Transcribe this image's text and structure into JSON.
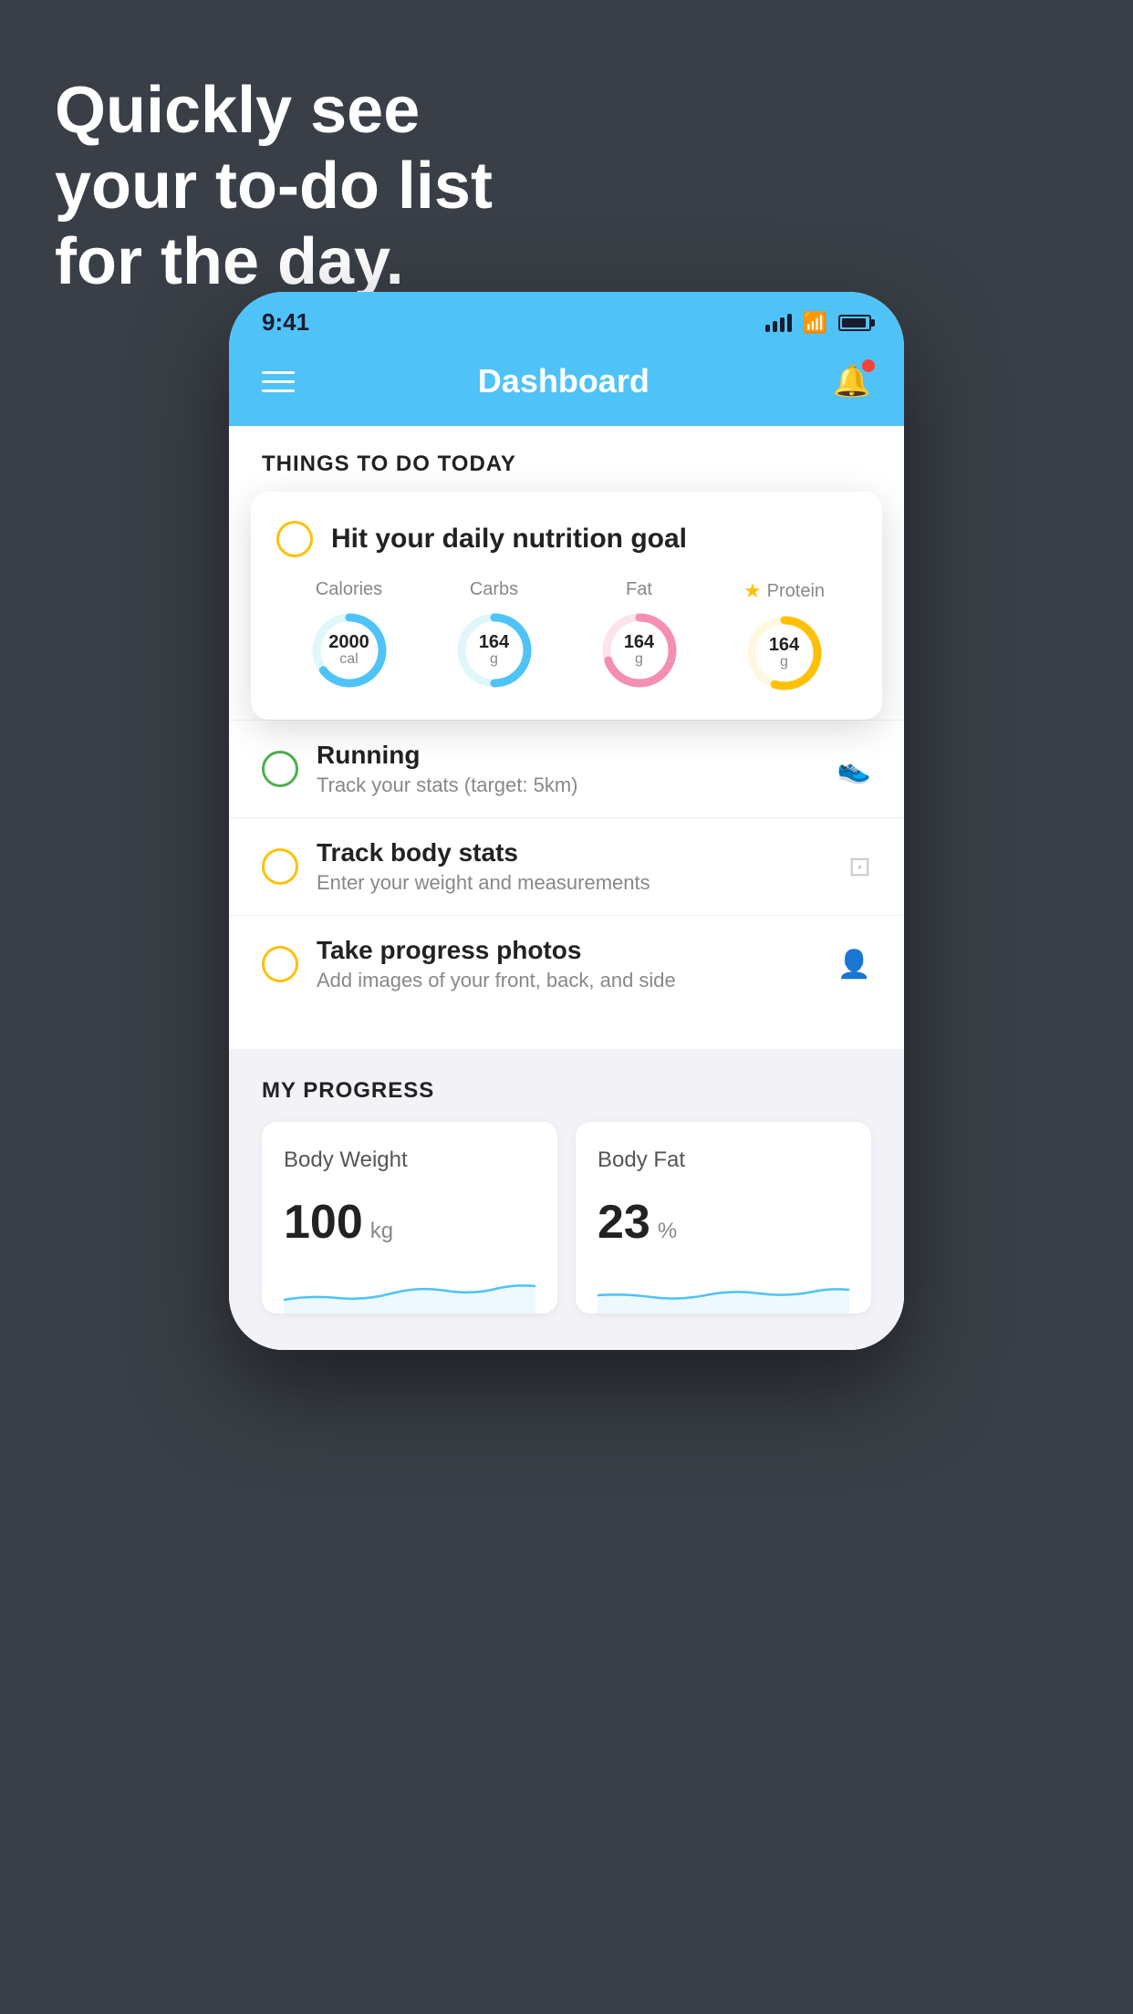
{
  "background": {
    "color": "#3a3f47"
  },
  "headline": {
    "line1": "Quickly see",
    "line2": "your to-do list",
    "line3": "for the day."
  },
  "statusBar": {
    "time": "9:41"
  },
  "navBar": {
    "title": "Dashboard"
  },
  "thingsToDo": {
    "sectionTitle": "THINGS TO DO TODAY",
    "floatingCard": {
      "title": "Hit your daily nutrition goal",
      "macros": [
        {
          "label": "Calories",
          "value": "2000",
          "unit": "cal",
          "color": "#4fc3f7",
          "trackColor": "#e0f7fa",
          "percent": 65,
          "starred": false
        },
        {
          "label": "Carbs",
          "value": "164",
          "unit": "g",
          "color": "#4fc3f7",
          "trackColor": "#e0f7fa",
          "percent": 50,
          "starred": false
        },
        {
          "label": "Fat",
          "value": "164",
          "unit": "g",
          "color": "#f48fb1",
          "trackColor": "#fce4ec",
          "percent": 70,
          "starred": false
        },
        {
          "label": "Protein",
          "value": "164",
          "unit": "g",
          "color": "#ffc107",
          "trackColor": "#fff8e1",
          "percent": 55,
          "starred": true
        }
      ]
    },
    "items": [
      {
        "title": "Running",
        "subtitle": "Track your stats (target: 5km)",
        "checkColor": "green",
        "icon": "shoe"
      },
      {
        "title": "Track body stats",
        "subtitle": "Enter your weight and measurements",
        "checkColor": "yellow",
        "icon": "scale"
      },
      {
        "title": "Take progress photos",
        "subtitle": "Add images of your front, back, and side",
        "checkColor": "yellow",
        "icon": "person"
      }
    ]
  },
  "myProgress": {
    "sectionTitle": "MY PROGRESS",
    "cards": [
      {
        "title": "Body Weight",
        "value": "100",
        "unit": "kg"
      },
      {
        "title": "Body Fat",
        "value": "23",
        "unit": "%"
      }
    ]
  }
}
